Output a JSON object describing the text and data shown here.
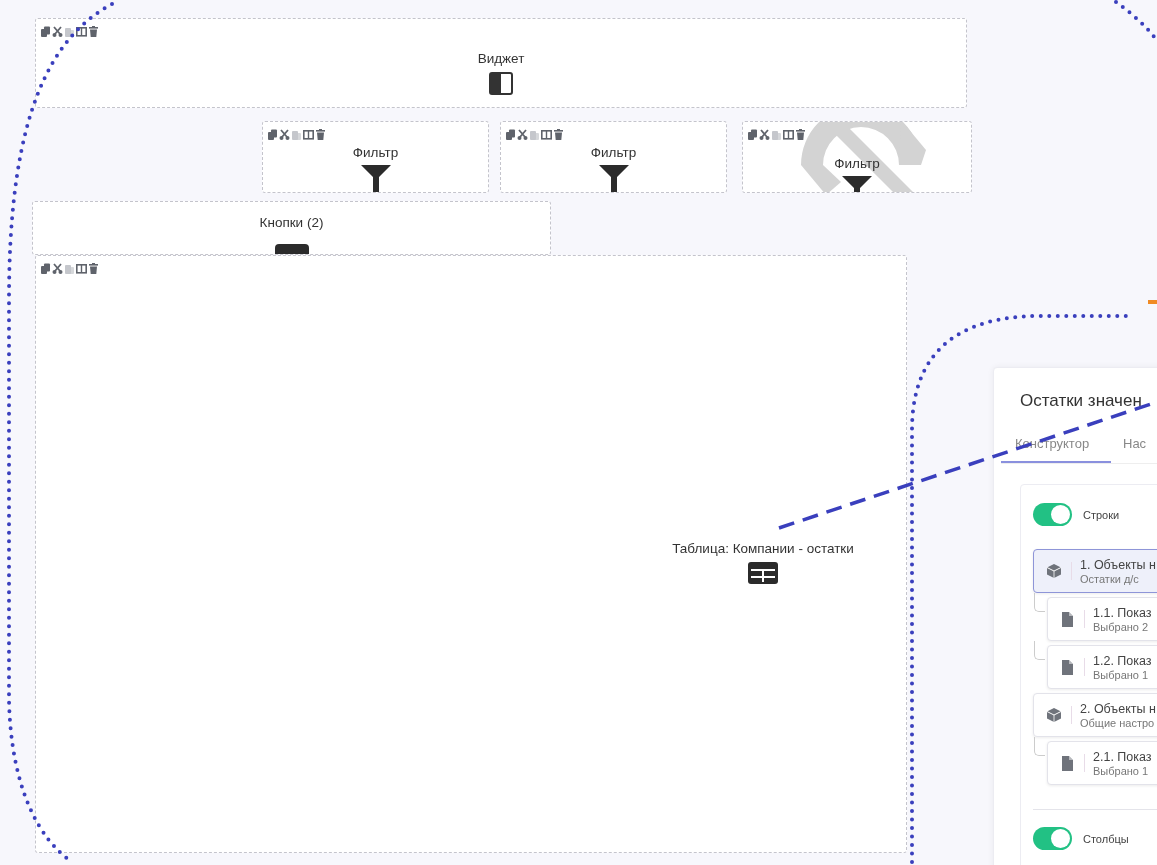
{
  "widget_tools": [
    {
      "kind": "copy",
      "disabled": false
    },
    {
      "kind": "cut",
      "disabled": false
    },
    {
      "kind": "paste",
      "disabled": true
    },
    {
      "kind": "columns",
      "disabled": false
    },
    {
      "kind": "delete",
      "disabled": false
    }
  ],
  "rows": [
    [
      {
        "kind": "widget",
        "label": "Виджет",
        "toolbar": true,
        "hidden": false
      }
    ],
    [
      {
        "kind": "filter",
        "label": "Фильтр",
        "toolbar": true,
        "hidden": false
      },
      {
        "kind": "filter",
        "label": "Фильтр",
        "toolbar": true,
        "hidden": false
      },
      {
        "kind": "filter",
        "label": "Фильтр",
        "toolbar": true,
        "hidden": true
      }
    ],
    [
      {
        "kind": "buttons",
        "label": "Кнопки (2)",
        "toolbar": false,
        "hidden": false
      }
    ],
    [
      {
        "kind": "table",
        "label": "Таблица: Компании - остатки",
        "toolbar": true,
        "hidden": false
      }
    ]
  ],
  "panel": {
    "title": "Остатки значен",
    "tabs": [
      {
        "label": "Конструктор",
        "selected": true
      },
      {
        "label": "Нас",
        "selected": false
      }
    ],
    "sections": [
      {
        "label": "Строки",
        "on": true,
        "items": [
          {
            "kind": "object",
            "title": "1. Объекты н",
            "subtitle": "Остатки д/с",
            "selected": true,
            "children": [
              {
                "kind": "indicator",
                "title": "1.1. Показ",
                "subtitle": "Выбрано 2",
                "selected": false
              },
              {
                "kind": "indicator",
                "title": "1.2. Показ",
                "subtitle": "Выбрано 1",
                "selected": false
              }
            ]
          },
          {
            "kind": "object",
            "title": "2. Объекты н",
            "subtitle": "Общие настро",
            "selected": false,
            "children": [
              {
                "kind": "indicator",
                "title": "2.1. Показ",
                "subtitle": "Выбрано 1",
                "selected": false
              }
            ]
          }
        ]
      },
      {
        "label": "Столбцы",
        "on": true
      }
    ]
  }
}
